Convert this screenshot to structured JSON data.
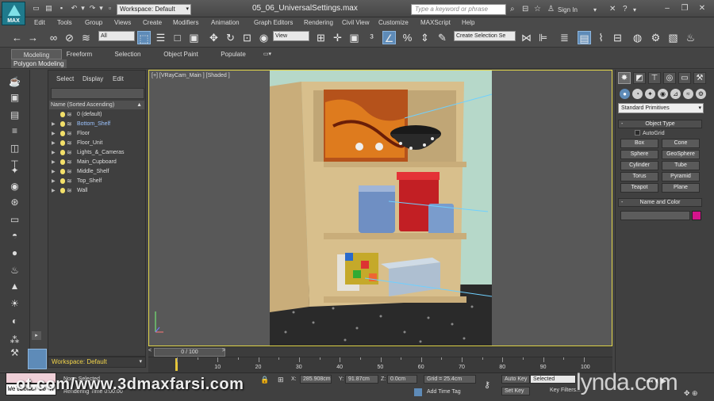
{
  "title_bar": {
    "app_logo": "MAX",
    "workspace": "Workspace: Default",
    "file_title": "05_06_UniversalSettings.max",
    "search_placeholder": "Type a keyword or phrase",
    "sign_in": "Sign In"
  },
  "menu": [
    "Edit",
    "Tools",
    "Group",
    "Views",
    "Create",
    "Modifiers",
    "Animation",
    "Graph Editors",
    "Rendering",
    "Civil View",
    "Customize",
    "MAXScript",
    "Help"
  ],
  "toolbar": {
    "selection_filter": "All",
    "reference_coord": "View",
    "named_selection": "Create Selection Se"
  },
  "ribbon": {
    "tabs": [
      "Modeling",
      "Freeform",
      "Selection",
      "Object Paint",
      "Populate"
    ],
    "sub_label": "Polygon Modeling"
  },
  "explorer": {
    "menu": [
      "Select",
      "Display",
      "Edit"
    ],
    "header": "Name (Sorted Ascending)",
    "layers": [
      "0 (default)",
      "Bottom_Shelf",
      "Floor",
      "Floor_Unit",
      "Lights_&_Cameras",
      "Main_Cupboard",
      "Middle_Shelf",
      "Top_Shelf",
      "Wall"
    ]
  },
  "workspace_bottom": "Workspace: Default",
  "viewport": {
    "label": "[+] [VRayCam_Main ] [Shaded ]"
  },
  "timeline": {
    "frame": "0 / 100",
    "prev": "<",
    "next": ">",
    "ticks": [
      "10",
      "20",
      "30",
      "40",
      "50",
      "60",
      "70",
      "80",
      "90",
      "100"
    ]
  },
  "status": {
    "listener": "Welcome to M",
    "selection": "None Selected",
    "render_time": "Rendering Time 0:00:00",
    "x_label": "X:",
    "x_value": "285.908cm",
    "y_label": "Y:",
    "y_value": "91.87cm",
    "z_label": "Z:",
    "z_value": "0.0cm",
    "grid": "Grid = 25.4cm",
    "add_time_tag": "Add Time Tag",
    "auto_key": "Auto Key",
    "set_key": "Set Key",
    "key_mode": "Selected",
    "key_filters": "Key Filters...",
    "watermark": "ot.com/www.3dmaxfarsi.com",
    "brand": "lynda.com"
  },
  "command_panel": {
    "dropdown": "Standard Primitives",
    "object_type": "Object Type",
    "autogrid": "AutoGrid",
    "buttons": [
      "Box",
      "Cone",
      "Sphere",
      "GeoSphere",
      "Cylinder",
      "Tube",
      "Torus",
      "Pyramid",
      "Teapot",
      "Plane"
    ],
    "name_and_color": "Name and Color",
    "swatch_color": "#d4148c"
  },
  "colors": {
    "accent": "#5e8bb8",
    "viewport_border": "#e2d64a",
    "workspace_text": "#f2d44a"
  }
}
